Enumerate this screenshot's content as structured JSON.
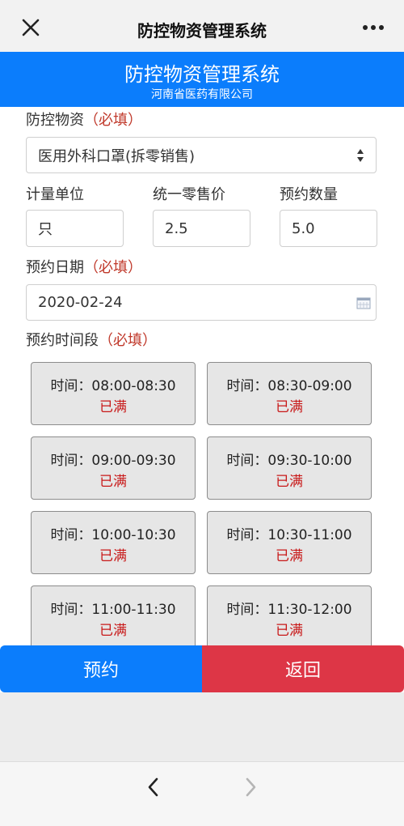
{
  "header": {
    "title": "防控物资管理系统"
  },
  "banner": {
    "title": "防控物资管理系统",
    "subtitle": "河南省医药有限公司"
  },
  "form": {
    "material": {
      "label": "防控物资",
      "required": "（必填）",
      "value": "医用外科口罩(拆零销售)"
    },
    "unit": {
      "label": "计量单位",
      "value": "只"
    },
    "price": {
      "label": "统一零售价",
      "value": "2.5"
    },
    "quantity": {
      "label": "预约数量",
      "value": "5.0"
    },
    "date": {
      "label": "预约日期",
      "required": "（必填）",
      "value": "2020-02-24"
    },
    "time_slot": {
      "label": "预约时间段",
      "required": "（必填）"
    }
  },
  "slots": [
    {
      "time": "时间：08:00-08:30",
      "status": "已满"
    },
    {
      "time": "时间：08:30-09:00",
      "status": "已满"
    },
    {
      "time": "时间：09:00-09:30",
      "status": "已满"
    },
    {
      "time": "时间：09:30-10:00",
      "status": "已满"
    },
    {
      "time": "时间：10:00-10:30",
      "status": "已满"
    },
    {
      "time": "时间：10:30-11:00",
      "status": "已满"
    },
    {
      "time": "时间：11:00-11:30",
      "status": "已满"
    },
    {
      "time": "时间：11:30-12:00",
      "status": "已满"
    }
  ],
  "actions": {
    "book": "预约",
    "back": "返回"
  },
  "colors": {
    "primary": "#0b7dfc",
    "danger": "#dd3646",
    "status_full": "#c81818",
    "required": "#c0392b"
  },
  "icons": {
    "close": "close-icon",
    "more": "more-icon",
    "select_arrow": "select-arrows-icon",
    "calendar": "calendar-icon",
    "nav_back": "chevron-left-icon",
    "nav_forward": "chevron-right-icon"
  }
}
